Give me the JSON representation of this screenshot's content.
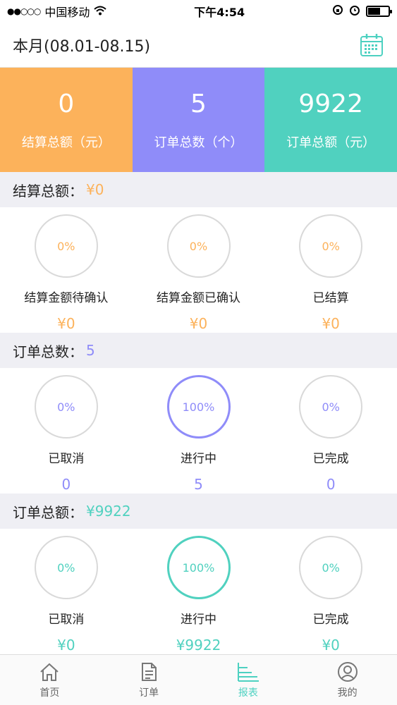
{
  "status_bar": {
    "signal": "●●○○○",
    "carrier": "中国移动",
    "time": "下午4:54",
    "battery_level": 0.55
  },
  "header": {
    "period": "本月(08.01-08.15)",
    "calendar_icon": "calendar-icon"
  },
  "colors": {
    "orange": "#fcb25b",
    "purple": "#8f8cf9",
    "teal": "#50d1bf",
    "ring_gray": "#d9d9d9"
  },
  "summary": [
    {
      "value": "0",
      "label": "结算总额（元）"
    },
    {
      "value": "5",
      "label": "订单总数（个）"
    },
    {
      "value": "9922",
      "label": "订单总额（元）"
    }
  ],
  "sections": {
    "settlement": {
      "title": "结算总额：",
      "amount": "¥0",
      "items": [
        {
          "percent": "0%",
          "label": "结算金额待确认",
          "value": "¥0"
        },
        {
          "percent": "0%",
          "label": "结算金额已确认",
          "value": "¥0"
        },
        {
          "percent": "0%",
          "label": "已结算",
          "value": "¥0"
        }
      ]
    },
    "order_count": {
      "title": "订单总数：",
      "amount": "5",
      "items": [
        {
          "percent": "0%",
          "label": "已取消",
          "value": "0"
        },
        {
          "percent": "100%",
          "label": "进行中",
          "value": "5"
        },
        {
          "percent": "0%",
          "label": "已完成",
          "value": "0"
        }
      ]
    },
    "order_amount": {
      "title": "订单总额：",
      "amount": "¥9922",
      "items": [
        {
          "percent": "0%",
          "label": "已取消",
          "value": "¥0"
        },
        {
          "percent": "100%",
          "label": "进行中",
          "value": "¥9922"
        },
        {
          "percent": "0%",
          "label": "已完成",
          "value": "¥0"
        }
      ]
    }
  },
  "tabbar": [
    {
      "label": "首页",
      "icon": "home-icon"
    },
    {
      "label": "订单",
      "icon": "order-document-icon"
    },
    {
      "label": "报表",
      "icon": "report-chart-icon",
      "active": true
    },
    {
      "label": "我的",
      "icon": "profile-icon"
    }
  ]
}
